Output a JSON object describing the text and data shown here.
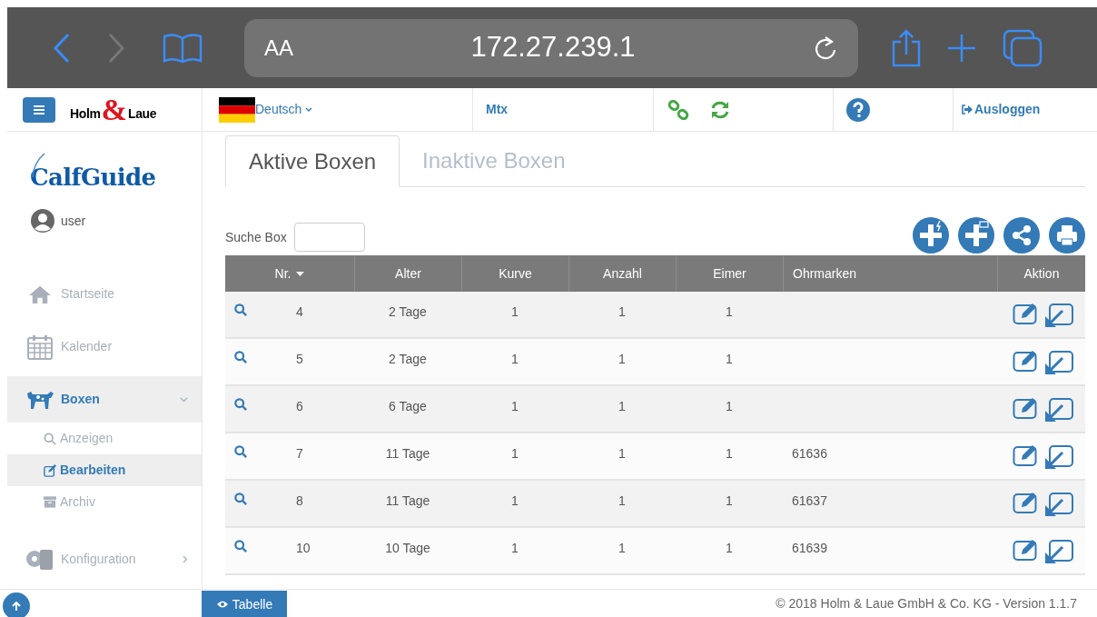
{
  "browser": {
    "text_size": "AA",
    "address": "172.27.239.1",
    "forward_disabled": true
  },
  "header": {
    "logo": {
      "left": "Holm",
      "amp": "&",
      "right": "Laue"
    },
    "language": "Deutsch",
    "device": "Mtx",
    "logout": "Ausloggen"
  },
  "sidebar": {
    "app_name": "CalfGuide",
    "user": "user",
    "items": [
      {
        "kind": "link",
        "label": "Startseite",
        "selected": false
      },
      {
        "kind": "link",
        "label": "Kalender",
        "selected": false
      },
      {
        "kind": "group",
        "label": "Boxen",
        "selected": true,
        "expanded": true,
        "children": [
          {
            "label": "Anzeigen",
            "selected": false
          },
          {
            "label": "Bearbeiten",
            "selected": true
          },
          {
            "label": "Archiv",
            "selected": false
          }
        ]
      },
      {
        "kind": "group",
        "label": "Konfiguration",
        "selected": false,
        "expanded": false
      }
    ]
  },
  "tabs": [
    {
      "label": "Aktive Boxen",
      "selected": true
    },
    {
      "label": "Inaktive Boxen",
      "selected": false
    }
  ],
  "search": {
    "label": "Suche Box"
  },
  "table": {
    "columns": [
      {
        "label": "Nr.",
        "sorted": true
      },
      {
        "label": "Alter",
        "sorted": false
      },
      {
        "label": "Kurve",
        "sorted": false
      },
      {
        "label": "Anzahl",
        "sorted": false
      },
      {
        "label": "Eimer",
        "sorted": false
      },
      {
        "label": "Ohrmarken",
        "sorted": false
      },
      {
        "label": "Aktion",
        "sorted": false
      }
    ],
    "rows": [
      {
        "nr": "4",
        "alter": "2 Tage",
        "kurve": "1",
        "anzahl": "1",
        "eimer": "1",
        "ohrmarken": ""
      },
      {
        "nr": "5",
        "alter": "2 Tage",
        "kurve": "1",
        "anzahl": "1",
        "eimer": "1",
        "ohrmarken": ""
      },
      {
        "nr": "6",
        "alter": "6 Tage",
        "kurve": "1",
        "anzahl": "1",
        "eimer": "1",
        "ohrmarken": ""
      },
      {
        "nr": "7",
        "alter": "11 Tage",
        "kurve": "1",
        "anzahl": "1",
        "eimer": "1",
        "ohrmarken": "61636"
      },
      {
        "nr": "8",
        "alter": "11 Tage",
        "kurve": "1",
        "anzahl": "1",
        "eimer": "1",
        "ohrmarken": "61637"
      },
      {
        "nr": "10",
        "alter": "10 Tage",
        "kurve": "1",
        "anzahl": "1",
        "eimer": "1",
        "ohrmarken": "61639"
      }
    ]
  },
  "footer": {
    "view_button": "Tabelle",
    "copyright": "© 2018 Holm & Laue GmbH & Co. KG - Version 1.1.7"
  }
}
